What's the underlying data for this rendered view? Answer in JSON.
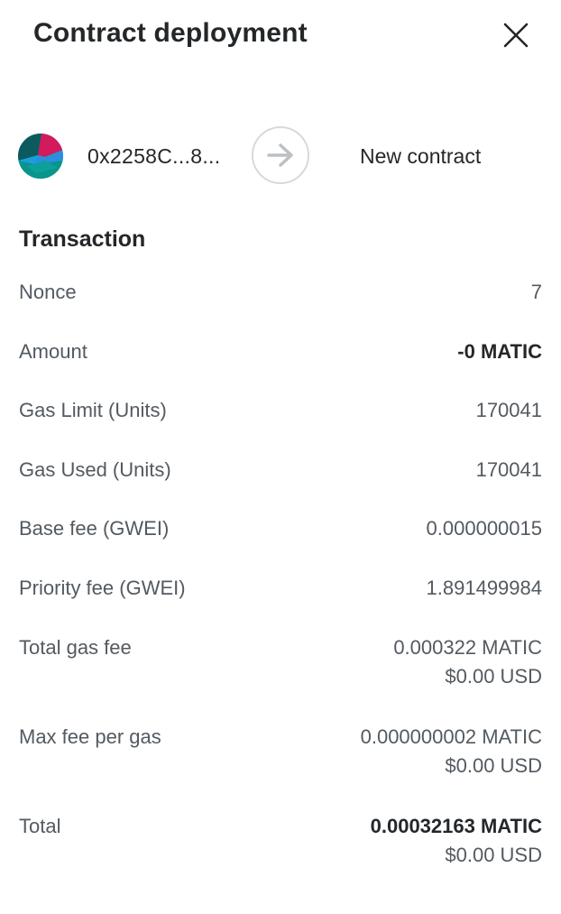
{
  "header": {
    "title": "Contract deployment",
    "close_icon": "close-icon"
  },
  "from_to": {
    "from_address": "0x2258C...8...",
    "avatar_icon": "account-avatar-icon",
    "arrow_icon": "arrow-right-icon",
    "to_label": "New contract"
  },
  "transaction": {
    "section_title": "Transaction",
    "rows": [
      {
        "label": "Nonce",
        "value": "7"
      },
      {
        "label": "Amount",
        "value": "-0 MATIC"
      },
      {
        "label": "Gas Limit (Units)",
        "value": "170041"
      },
      {
        "label": "Gas Used (Units)",
        "value": "170041"
      },
      {
        "label": "Base fee (GWEI)",
        "value": "0.000000015"
      },
      {
        "label": "Priority fee (GWEI)",
        "value": "1.891499984"
      },
      {
        "label": "Total gas fee",
        "value": "0.000322 MATIC",
        "sub_value": "$0.00 USD"
      },
      {
        "label": "Max fee per gas",
        "value": "0.000000002 MATIC",
        "sub_value": "$0.00 USD"
      },
      {
        "label": "Total",
        "value": "0.00032163 MATIC",
        "sub_value": "$0.00 USD"
      }
    ]
  },
  "colors": {
    "text_primary": "#24272a",
    "text_secondary": "#535a61",
    "border": "#d6d9dc",
    "arrow": "#bbc0c5"
  }
}
